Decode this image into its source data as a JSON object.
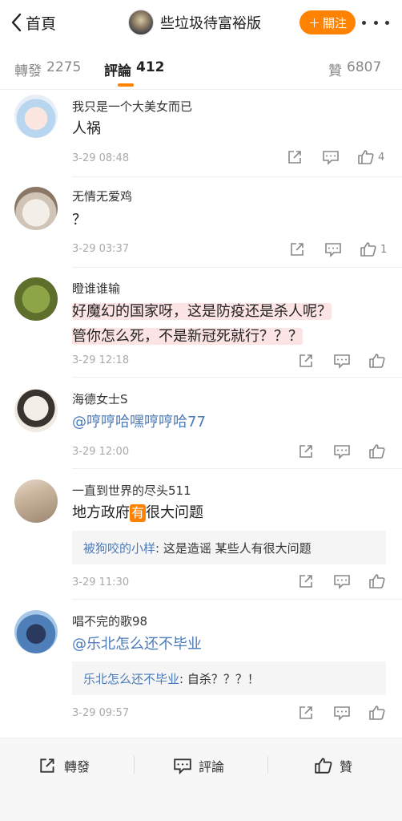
{
  "header": {
    "back_label": "首頁",
    "title": "些垃圾待富裕版",
    "follow_label": "關注"
  },
  "tabs": [
    {
      "label": "轉發",
      "count": "2275"
    },
    {
      "label": "評論",
      "count": "412"
    },
    {
      "label": "贊",
      "count": "6807"
    }
  ],
  "comments": [
    {
      "name": "我只是一个大美女而已",
      "text": "人祸",
      "time": "3-29 08:48",
      "likes": "4"
    },
    {
      "name": "无情无爱鸡",
      "text": "？",
      "time": "3-29 03:37",
      "likes": "1"
    },
    {
      "name": "瞪谁谁输",
      "text_line1": "好魔幻的国家呀，这是防疫还是杀人呢？",
      "text_line2": "管你怎么死，不是新冠死就行？？？",
      "time": "3-29 12:18",
      "likes": ""
    },
    {
      "name": "海德女士S",
      "text": "@哼哼哈嘿哼哼哈77",
      "time": "3-29 12:00",
      "likes": ""
    },
    {
      "name": "一直到世界的尽头511",
      "text_pre": "地方政府",
      "text_tag": "有",
      "text_post": "很大问题",
      "reply_name": "被狗咬的小样",
      "reply_text": ": 这是造谣 某些人有很大问题",
      "time": "3-29 11:30",
      "likes": ""
    },
    {
      "name": "唱不完的歌98",
      "text": "@乐北怎么还不毕业",
      "reply_name": "乐北怎么还不毕业",
      "reply_text": ": 自杀？？？！",
      "time": "3-29 09:57",
      "likes": ""
    }
  ],
  "bottom_bar": {
    "repost_label": "轉發",
    "comment_label": "評論",
    "like_label": "贊"
  },
  "colors": {
    "accent": "#ff8200",
    "link": "#4a7ab8",
    "highlight": "#fde4e4"
  }
}
